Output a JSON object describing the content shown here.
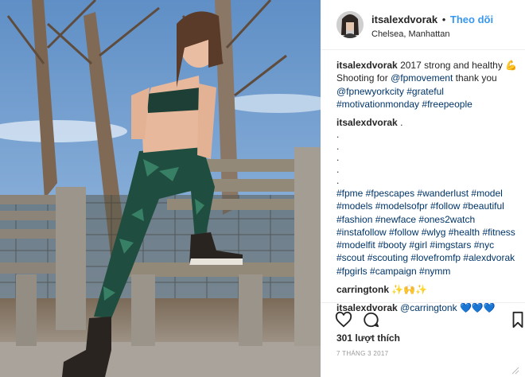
{
  "post": {
    "author": "itsalexdvorak",
    "separator": "•",
    "follow_label": "Theo dõi",
    "location": "Chelsea, Manhattan"
  },
  "caption": {
    "user": "itsalexdvorak",
    "text": "2017 strong and healthy 💪",
    "line2_text": "Shooting for",
    "mention1": "@fpmovement",
    "line2_tail": "thank you",
    "mention2": "@fpnewyorkcity",
    "tag_grateful": "#grateful",
    "tag_motivation": "#motivationmonday",
    "tag_freepeople": "#freepeople"
  },
  "comments": [
    {
      "user": "itsalexdvorak",
      "text": ".",
      "dots": [
        ".",
        ".",
        ".",
        ".",
        "."
      ],
      "hashtags": "#fpme #fpescapes #wanderlust #model #models #modelsofpr #follow #beautiful #fashion #newface #ones2watch #instafollow #follow #wlyg #health #fitness #modelfit #booty #girl #imgstars #nyc #scout #scouting #lovefromfp #alexdvorak #fpgirls #campaign #nymm"
    },
    {
      "user": "carringtonk",
      "text": "✨🙌✨"
    },
    {
      "user": "itsalexdvorak",
      "mention": "@carringtonk",
      "text": "💙💙💙"
    }
  ],
  "actions": {
    "like_icon": "heart-icon",
    "comment_icon": "comment-icon",
    "save_icon": "bookmark-icon"
  },
  "likes_label": "301 lượt thích",
  "date_label": "7 THÁNG 3 2017",
  "colors": {
    "link_blue": "#3897f0",
    "hashtag": "#003569",
    "text": "#262626",
    "muted": "#999999",
    "divider": "#efefef"
  }
}
